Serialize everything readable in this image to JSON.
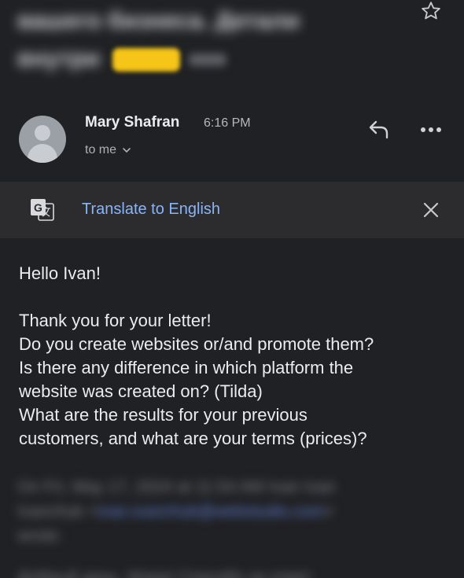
{
  "subject": {
    "line1": "вашего бизнеса. Детали",
    "line2": "внутри",
    "label_chip": "",
    "label_tail": "Inbox"
  },
  "sender": {
    "name": "Mary Shafran",
    "time": "6:16 PM",
    "recipient": "to me"
  },
  "translate_bar": {
    "link_text": "Translate to English"
  },
  "message": {
    "greeting": "Hello Ivan!",
    "lines": [
      "Thank you for your letter!",
      "Do you create websites or/and promote them?",
      "Is there any difference in which platform the",
      "website was created on? (Tilda)",
      "What are the results for your previous",
      "customers, and what are your terms (prices)?"
    ]
  },
  "quoted": {
    "line1": "On Fri, May 17, 2024 at 11:54 AM Ivan Ivan",
    "line2_prefix": "Ivanchuk <",
    "line2_link": "ivan.ivanchuk@webstudio.com",
    "line2_suffix": ">",
    "line3": "wrote:",
    "line4": "Добрый день, Мэри! Спасибо за ответ"
  },
  "icons": {
    "star": "star-outline-icon",
    "reply": "reply-icon",
    "more": "more-horizontal-icon",
    "translate": "google-translate-icon",
    "close": "close-icon",
    "chevron": "chevron-down-icon",
    "avatar": "person-avatar-icon"
  },
  "colors": {
    "background": "#202124",
    "translate_bar": "#2c2c2f",
    "link": "#8ab4f8",
    "label_chip": "#f5c518"
  }
}
